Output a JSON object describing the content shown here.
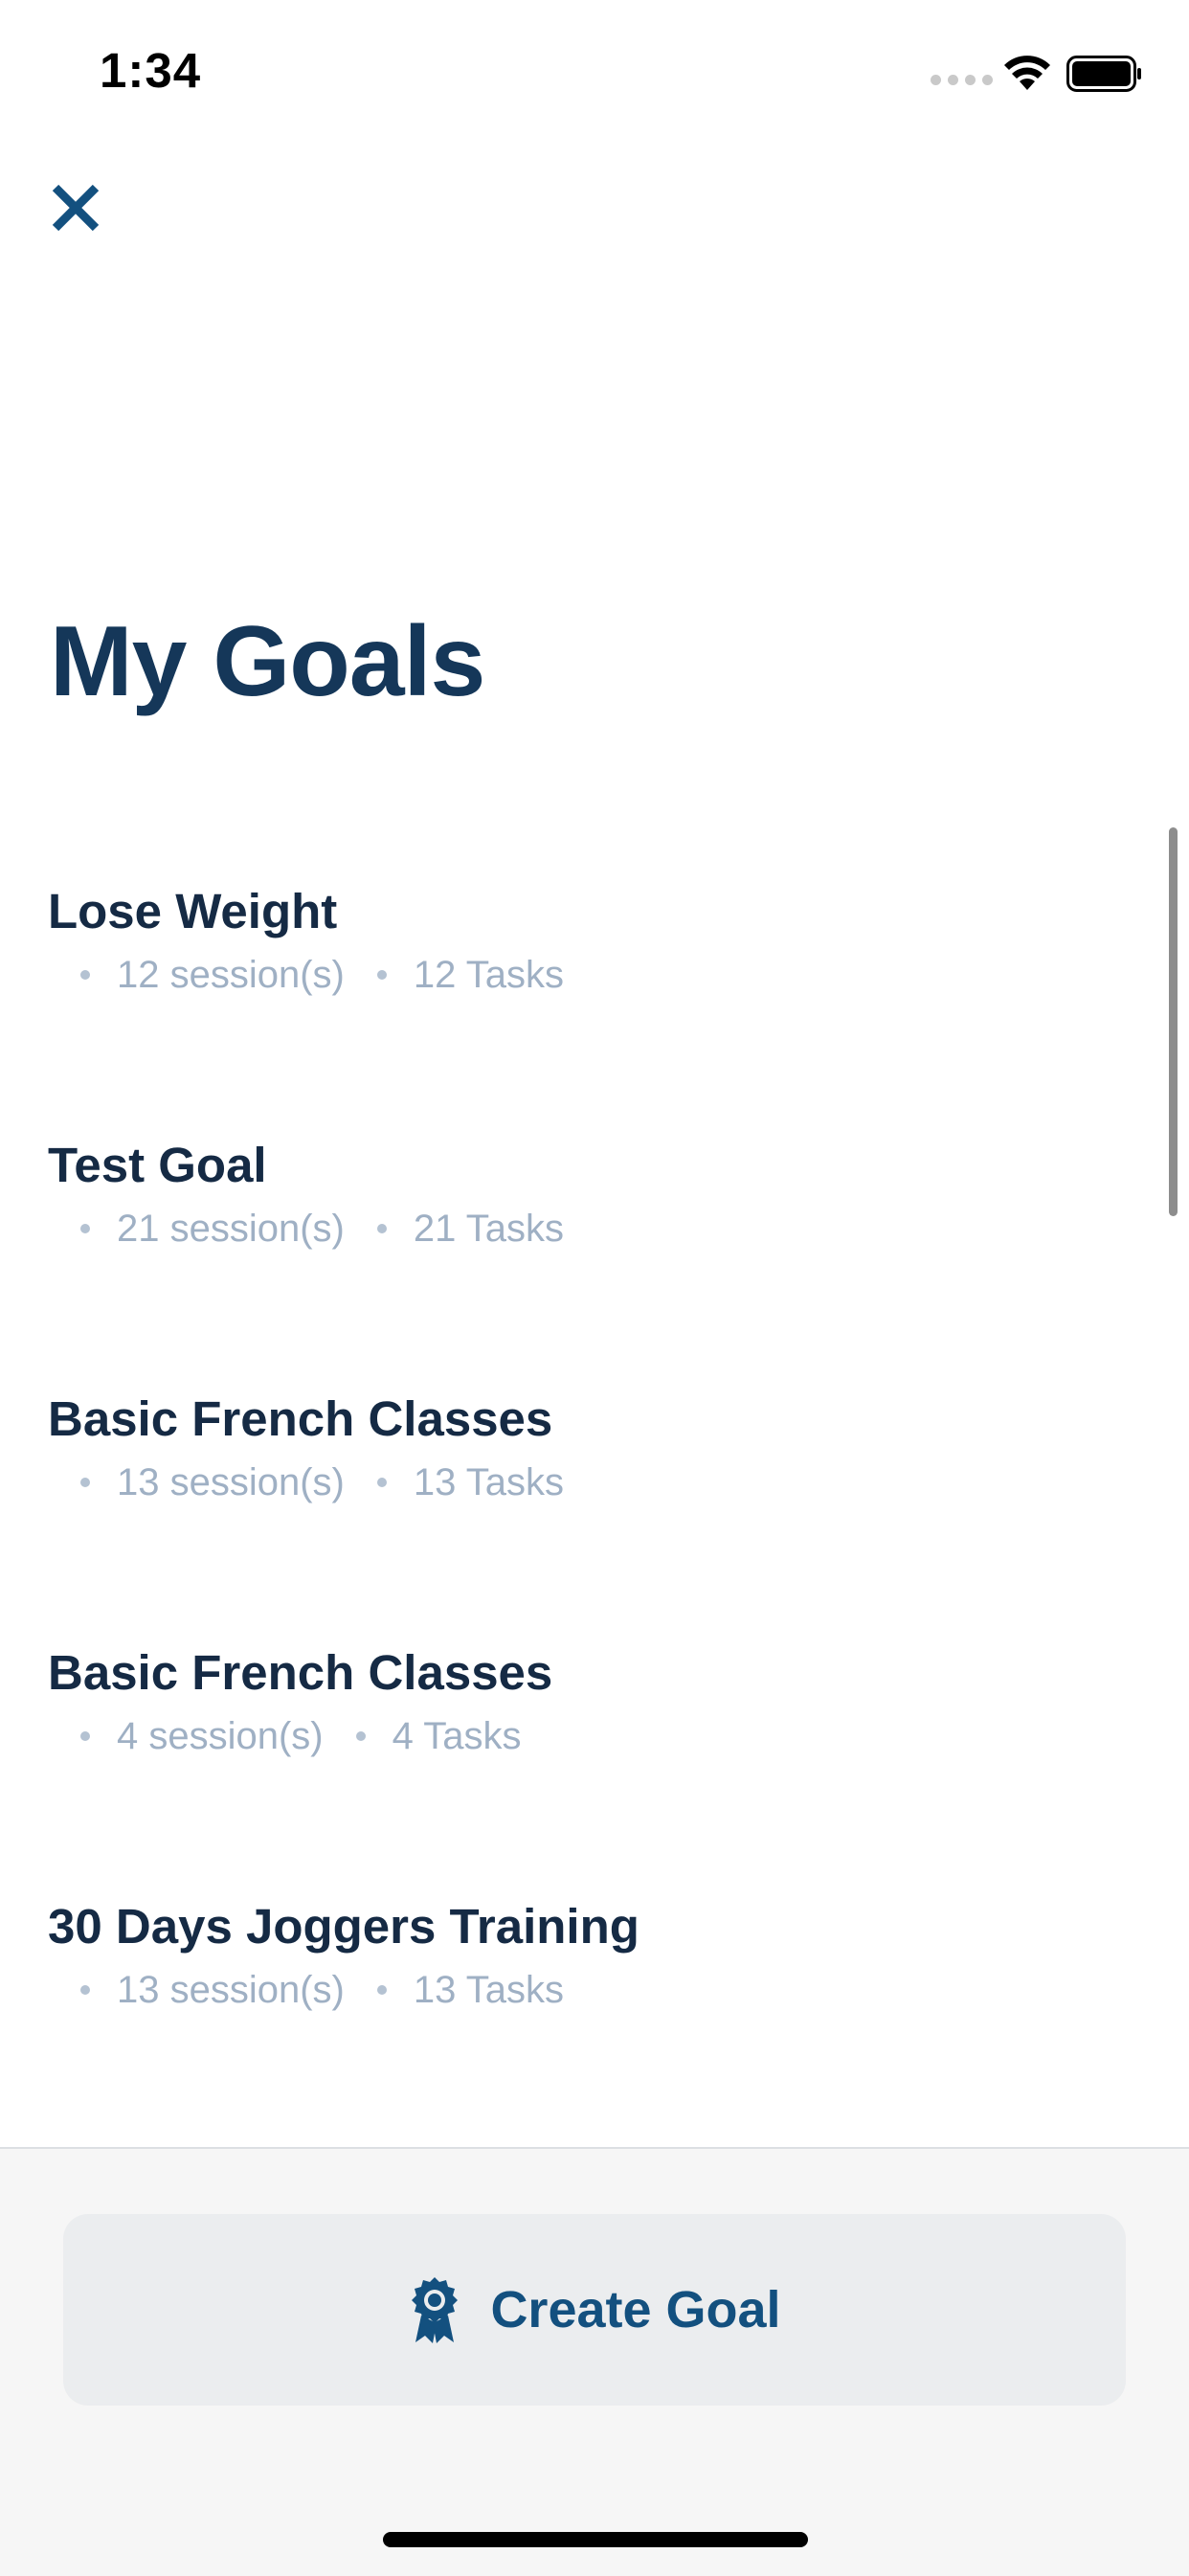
{
  "status_bar": {
    "time": "1:34"
  },
  "page": {
    "title": "My Goals"
  },
  "goals": [
    {
      "title": "Lose Weight",
      "sessions": "12 session(s)",
      "tasks": "12 Tasks"
    },
    {
      "title": "Test Goal",
      "sessions": "21 session(s)",
      "tasks": "21 Tasks"
    },
    {
      "title": "Basic French Classes",
      "sessions": "13 session(s)",
      "tasks": "13 Tasks"
    },
    {
      "title": "Basic French Classes",
      "sessions": "4 session(s)",
      "tasks": "4 Tasks"
    },
    {
      "title": "30 Days Joggers Training",
      "sessions": "13 session(s)",
      "tasks": "13 Tasks"
    }
  ],
  "actions": {
    "create_goal_label": "Create Goal"
  },
  "icons": {
    "close": "close-icon",
    "create": "award-ribbon-icon",
    "wifi": "wifi-icon",
    "battery": "battery-icon"
  },
  "colors": {
    "title": "#153759",
    "accent": "#13507f",
    "goal_title": "#152a44",
    "meta": "#9fb0c4"
  }
}
